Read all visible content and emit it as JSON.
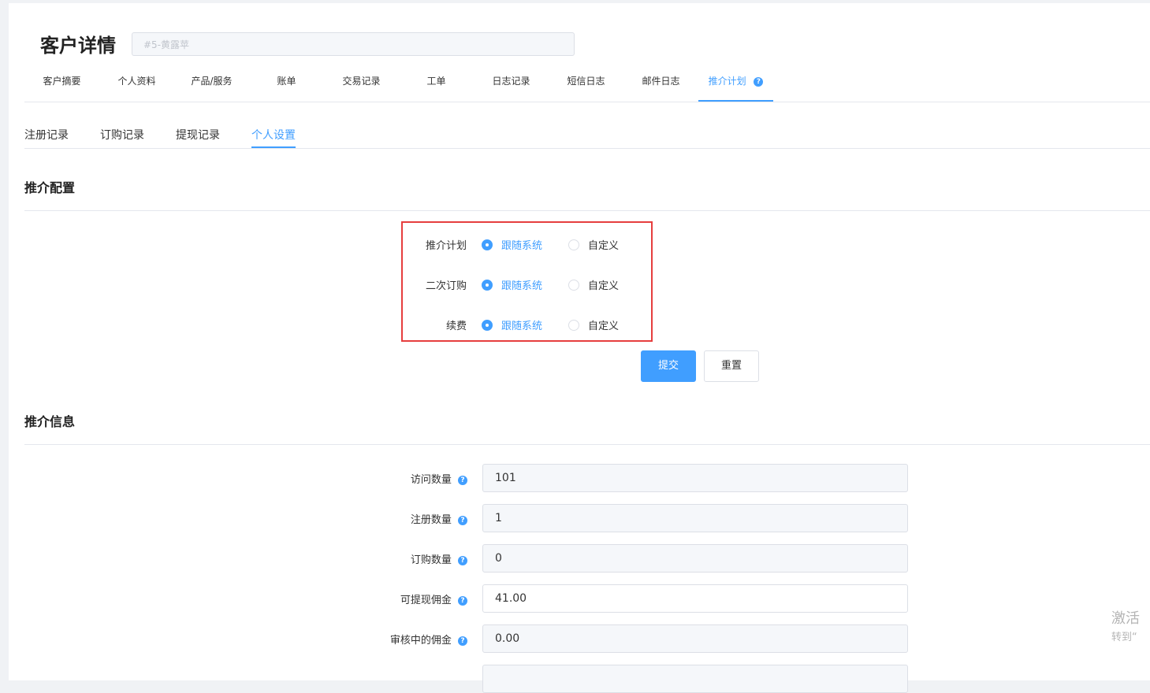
{
  "header": {
    "title": "客户详情",
    "client_select_value": "#5-黄露苹"
  },
  "main_tabs": [
    {
      "label": "客户摘要"
    },
    {
      "label": "个人资料"
    },
    {
      "label": "产品/服务"
    },
    {
      "label": "账单"
    },
    {
      "label": "交易记录"
    },
    {
      "label": "工单"
    },
    {
      "label": "日志记录"
    },
    {
      "label": "短信日志"
    },
    {
      "label": "邮件日志"
    },
    {
      "label": "推介计划",
      "active": true,
      "help_icon": "?"
    }
  ],
  "sub_tabs": [
    {
      "label": "注册记录"
    },
    {
      "label": "订购记录"
    },
    {
      "label": "提现记录"
    },
    {
      "label": "个人设置",
      "active": true
    }
  ],
  "config_section": {
    "title": "推介配置",
    "rows": [
      {
        "label": "推介计划",
        "option1": "跟随系统",
        "option2": "自定义",
        "selected": "option1"
      },
      {
        "label": "二次订购",
        "option1": "跟随系统",
        "option2": "自定义",
        "selected": "option1"
      },
      {
        "label": "续费",
        "option1": "跟随系统",
        "option2": "自定义",
        "selected": "option1"
      }
    ],
    "submit_label": "提交",
    "reset_label": "重置"
  },
  "info_section": {
    "title": "推介信息",
    "help_icon": "?",
    "fields": [
      {
        "label": "访问数量",
        "value": "101",
        "editable": false
      },
      {
        "label": "注册数量",
        "value": "1",
        "editable": false
      },
      {
        "label": "订购数量",
        "value": "0",
        "editable": false
      },
      {
        "label": "可提现佣金",
        "value": "41.00",
        "editable": true
      },
      {
        "label": "审核中的佣金",
        "value": "0.00",
        "editable": false
      }
    ]
  },
  "watermark": {
    "line1": "激活",
    "line2": "转到“"
  },
  "colors": {
    "accent": "#409eff",
    "highlight_border": "#e63e3e"
  }
}
